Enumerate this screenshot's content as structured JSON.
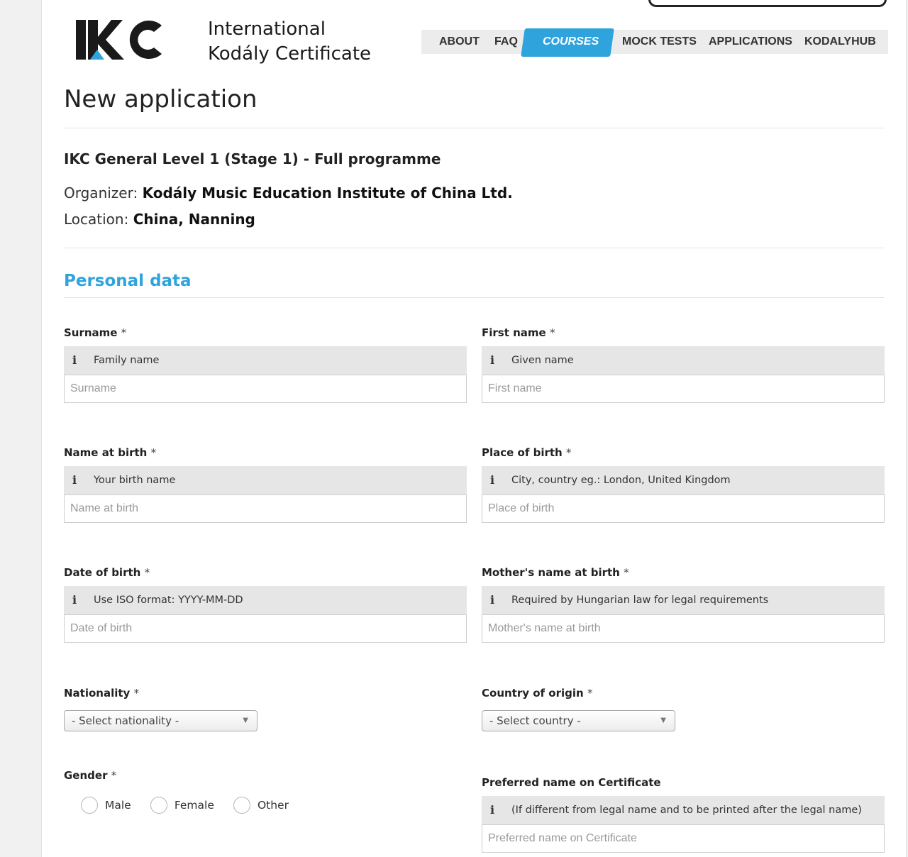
{
  "brand": {
    "logo_mark": "IKC",
    "name_line1": "International",
    "name_line2": "Kodály Certificate"
  },
  "nav": {
    "items": [
      {
        "label": "ABOUT",
        "active": false
      },
      {
        "label": "FAQ",
        "active": false
      },
      {
        "label": "COURSES",
        "active": true
      },
      {
        "label": "MOCK TESTS",
        "active": false
      },
      {
        "label": "APPLICATIONS",
        "active": false
      },
      {
        "label": "KODALYHUB",
        "active": false
      }
    ],
    "active_color": "#2fa4dc"
  },
  "page": {
    "title": "New application",
    "course": "IKC General Level 1 (Stage 1) - Full programme",
    "organizer_label": "Organizer:",
    "organizer_value": "Kodály Music Education Institute of China Ltd.",
    "location_label": "Location:",
    "location_value": "China, Nanning"
  },
  "section": {
    "title": "Personal data",
    "color": "#2fa4dc"
  },
  "form": {
    "required_mark": "*",
    "info_icon": "info-icon",
    "surname": {
      "label": "Surname",
      "hint": "Family name",
      "placeholder": "Surname"
    },
    "first_name": {
      "label": "First name",
      "hint": "Given name",
      "placeholder": "First name"
    },
    "name_at_birth": {
      "label": "Name at birth",
      "hint": "Your birth name",
      "placeholder": "Name at birth"
    },
    "place_of_birth": {
      "label": "Place of birth",
      "hint": "City, country eg.: London, United Kingdom",
      "placeholder": "Place of birth"
    },
    "date_of_birth": {
      "label": "Date of birth",
      "hint": "Use ISO format: YYYY-MM-DD",
      "placeholder": "Date of birth"
    },
    "mothers_name": {
      "label": "Mother's name at birth",
      "hint": "Required by Hungarian law for legal requirements",
      "placeholder": "Mother's name at birth"
    },
    "nationality": {
      "label": "Nationality",
      "selected": "- Select nationality -"
    },
    "country_of_origin": {
      "label": "Country of origin",
      "selected": "- Select country -"
    },
    "gender": {
      "label": "Gender",
      "options": [
        "Male",
        "Female",
        "Other"
      ]
    },
    "preferred_name": {
      "label": "Preferred name on Certificate",
      "hint": "(If different from legal name and to be printed after the legal name)",
      "placeholder": "Preferred name on Certificate"
    }
  }
}
